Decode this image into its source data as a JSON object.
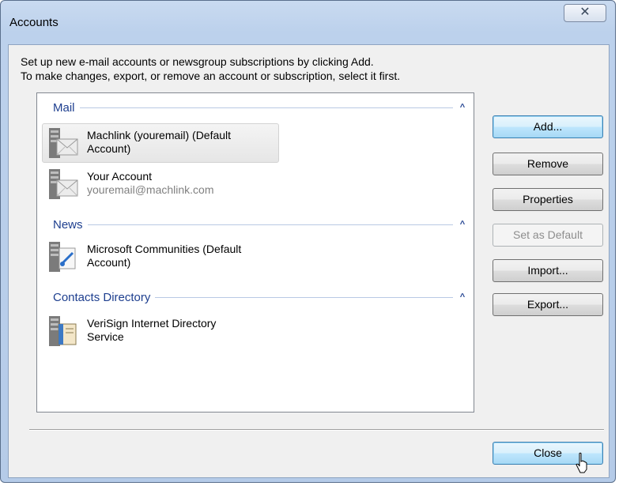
{
  "window": {
    "title": "Accounts",
    "close_glyph": "✕"
  },
  "intro": {
    "line1": "Set up new e-mail accounts or newsgroup subscriptions by clicking Add.",
    "line2": "To make changes, export, or remove an account or subscription, select it first."
  },
  "groups": {
    "mail": {
      "label": "Mail",
      "items": [
        {
          "line1": "Machlink (youremail) (Default",
          "line2": "Account)",
          "icon": "mail-server-icon",
          "selected": true
        },
        {
          "line1": "Your Account",
          "line2": "youremail@machlink.com",
          "icon": "mail-server-icon",
          "selected": false
        }
      ]
    },
    "news": {
      "label": "News",
      "items": [
        {
          "line1": "Microsoft Communities (Default",
          "line2": "Account)",
          "icon": "news-server-icon"
        }
      ]
    },
    "contacts": {
      "label": "Contacts Directory",
      "items": [
        {
          "line1": "VeriSign Internet Directory",
          "line2": "Service",
          "icon": "directory-server-icon"
        }
      ]
    },
    "collapse_glyph": "^"
  },
  "buttons": {
    "add": "Add...",
    "remove": "Remove",
    "properties": "Properties",
    "set_default": "Set as Default",
    "import": "Import...",
    "export": "Export...",
    "close": "Close"
  }
}
